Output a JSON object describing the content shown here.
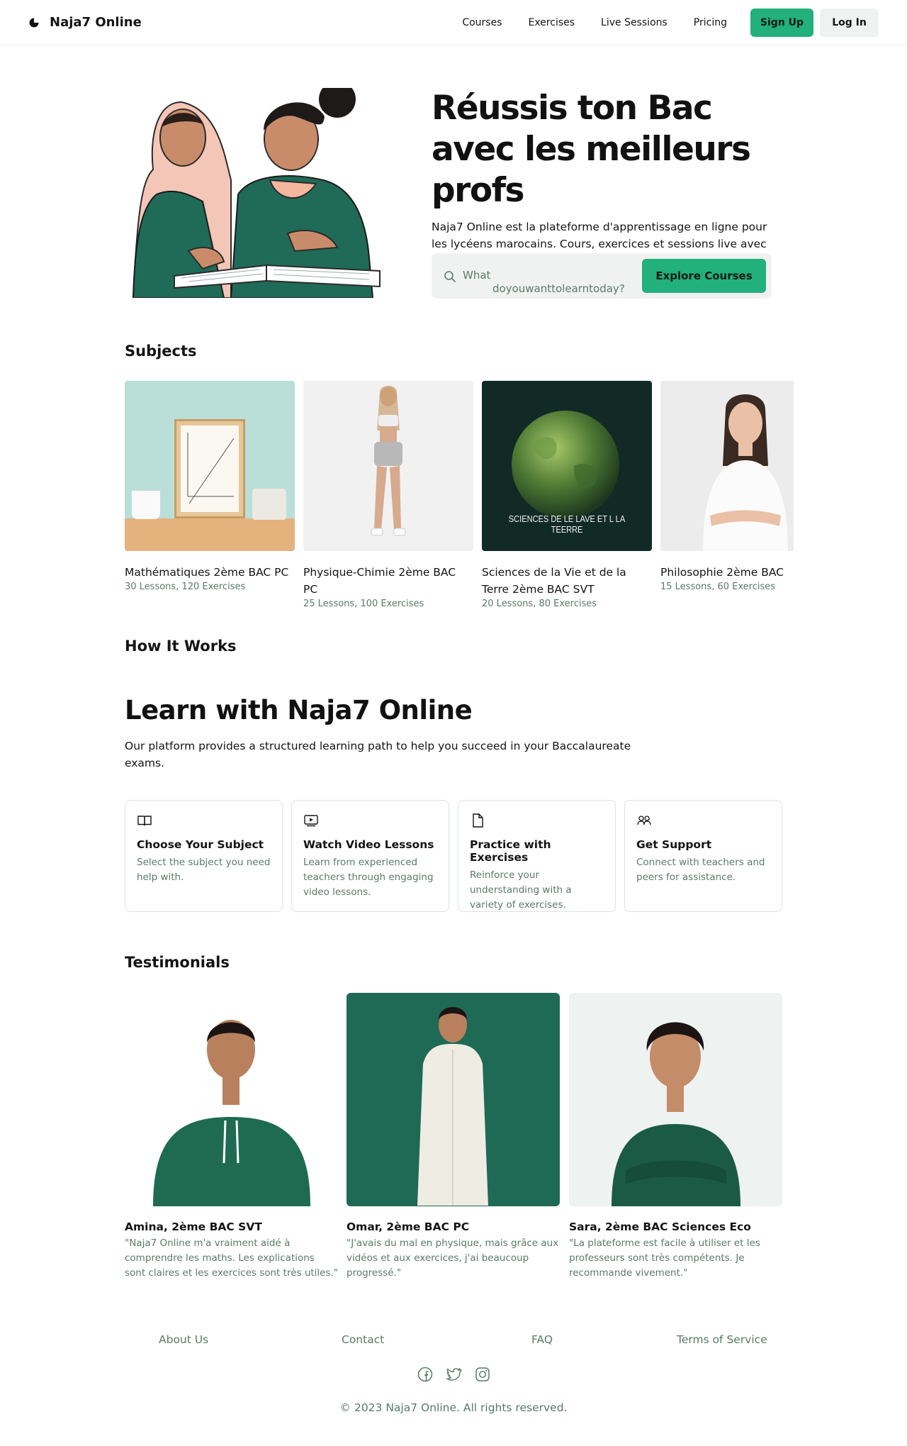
{
  "nav": {
    "brand": "Naja7 Online",
    "links": [
      "Courses",
      "Exercises",
      "Live Sessions",
      "Pricing"
    ],
    "signup": "Sign Up",
    "login": "Log In"
  },
  "hero": {
    "title": "Réussis ton Bac avec les meilleurs profs",
    "subtitle": "Naja7 Online est la plateforme d'apprentissage en ligne pour les lycéens marocains. Cours, exercices et sessions live avec des professeurs expérimentés.",
    "search_placeholder_line1": "What",
    "search_placeholder_line2": "doyouwanttolearntoday?",
    "cta": "Explore Courses"
  },
  "subjects": {
    "heading": "Subjects",
    "items": [
      {
        "title": "Mathématiques 2ème BAC PC",
        "meta": "30 Lessons, 120 Exercises"
      },
      {
        "title": "Physique-Chimie 2ème BAC PC",
        "meta": "25 Lessons, 100 Exercises"
      },
      {
        "title": "Sciences de la Vie et de la Terre 2ème BAC SVT",
        "meta": "20 Lessons, 80 Exercises",
        "image_caption": "SCIENCES DE LE LAVE ET L LA TEERRE"
      },
      {
        "title": "Philosophie 2ème BAC",
        "meta": "15 Lessons, 60 Exercises"
      }
    ]
  },
  "how": {
    "heading": "How It Works",
    "title": "Learn with Naja7 Online",
    "subtitle": "Our platform provides a structured learning path to help you succeed in your Baccalaureate exams.",
    "steps": [
      {
        "icon": "book-icon",
        "title": "Choose Your Subject",
        "desc": "Select the subject you need help with."
      },
      {
        "icon": "video-icon",
        "title": "Watch Video Lessons",
        "desc": "Learn from experienced teachers through engaging video lessons."
      },
      {
        "icon": "document-icon",
        "title": "Practice with Exercises",
        "desc": "Reinforce your understanding with a variety of exercises."
      },
      {
        "icon": "users-icon",
        "title": "Get Support",
        "desc": "Connect with teachers and peers for assistance."
      }
    ]
  },
  "testimonials": {
    "heading": "Testimonials",
    "items": [
      {
        "name": "Amina, 2ème BAC SVT",
        "quote": "\"Naja7 Online m'a vraiment aidé à comprendre les maths. Les explications sont claires et les exercices sont très utiles.\""
      },
      {
        "name": "Omar, 2ème BAC PC",
        "quote": "\"J'avais du mal en physique, mais grâce aux vidéos et aux exercices, j'ai beaucoup progressé.\""
      },
      {
        "name": "Sara, 2ème BAC Sciences Eco",
        "quote": "\"La plateforme est facile à utiliser et les professeurs sont très compétents. Je recommande vivement.\""
      }
    ]
  },
  "footer": {
    "links": [
      "About Us",
      "Contact",
      "FAQ",
      "Terms of Service"
    ],
    "socials": [
      "facebook-icon",
      "twitter-icon",
      "instagram-icon"
    ],
    "copyright": "© 2023 Naja7 Online. All rights reserved."
  },
  "colors": {
    "accent": "#22b07d",
    "muted_text": "#5a7a6b",
    "button_grey": "#f0f2f1",
    "border": "#dbe2de"
  }
}
